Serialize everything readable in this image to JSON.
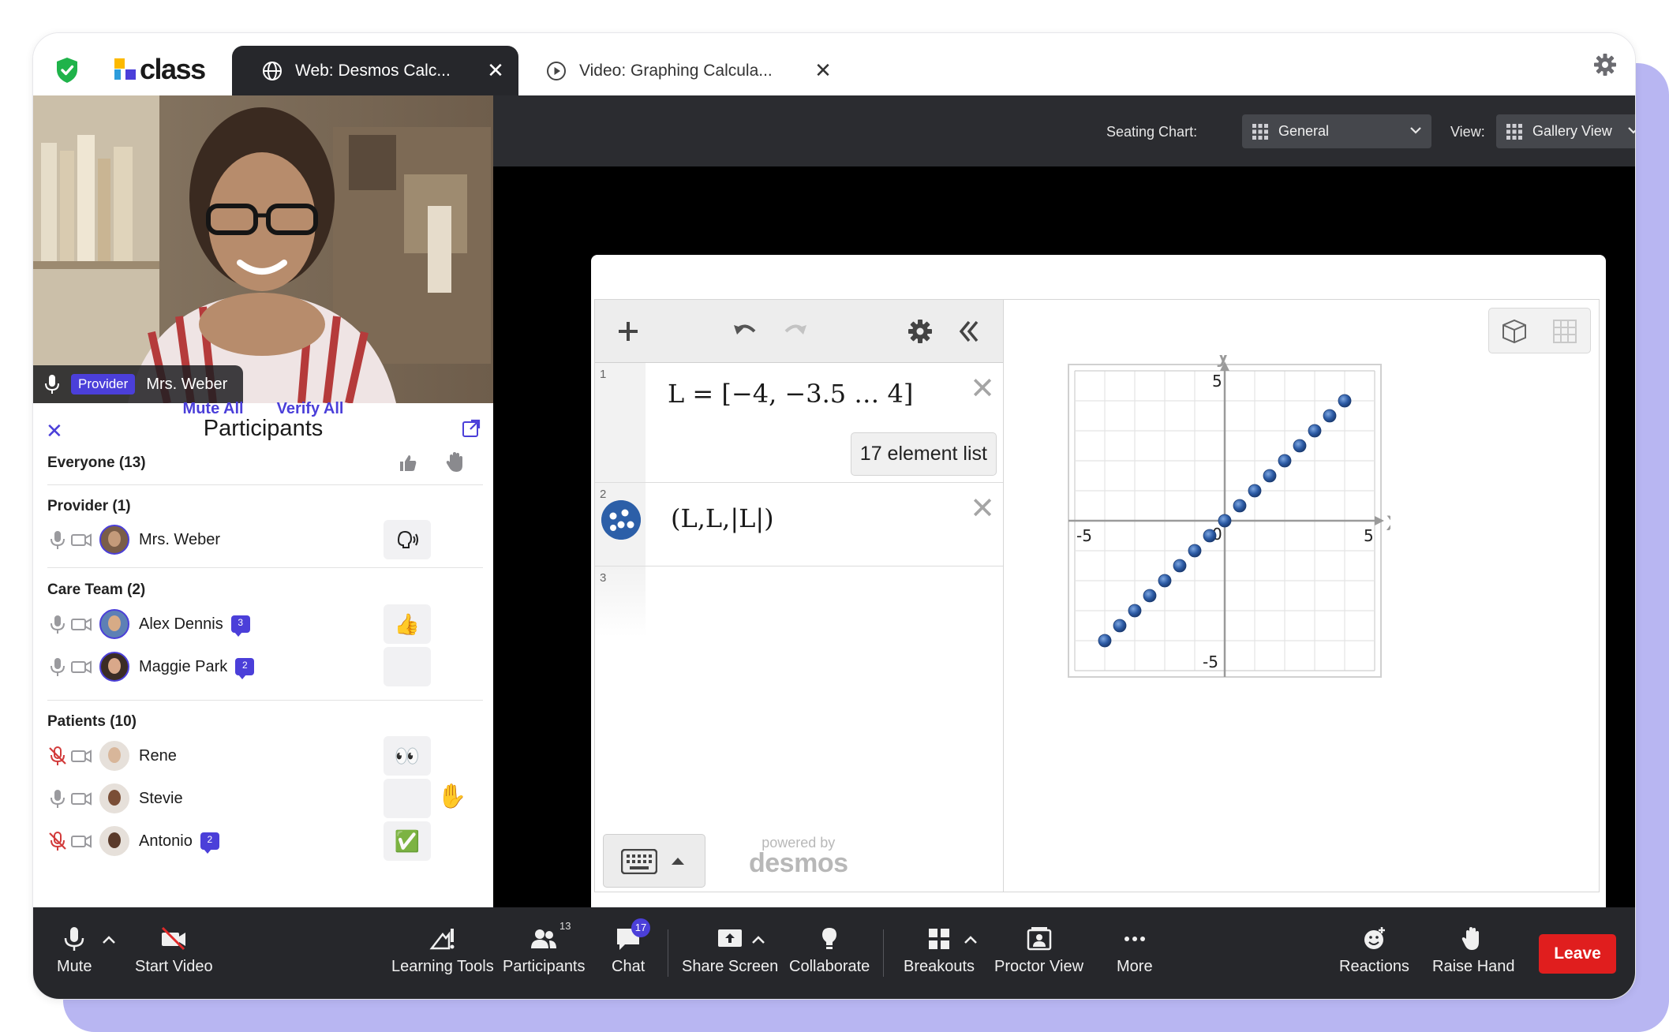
{
  "app": {
    "logo_text": "class",
    "tabs": [
      {
        "label": "Web: Desmos Calc...",
        "icon": "globe-icon",
        "active": true
      },
      {
        "label": "Video: Graphing Calcula...",
        "icon": "play-circle-icon",
        "active": false
      }
    ],
    "close_glyph": "✕"
  },
  "video": {
    "speaker_role": "Provider",
    "speaker_name": "Mrs. Weber"
  },
  "participants_panel": {
    "title": "Participants",
    "mute_all": "Mute All",
    "verify_all": "Verify All",
    "everyone": "Everyone (13)",
    "groups": {
      "provider": {
        "label": "Provider (1)",
        "members": [
          {
            "name": "Mrs. Weber",
            "reaction": "speaking-icon"
          }
        ]
      },
      "care_team": {
        "label": "Care Team (2)",
        "members": [
          {
            "name": "Alex Dennis",
            "messages": "3",
            "reaction": "👍"
          },
          {
            "name": "Maggie Park",
            "messages": "2",
            "reaction": ""
          }
        ]
      },
      "patients": {
        "label": "Patients (10)",
        "members": [
          {
            "name": "Rene",
            "muted": true,
            "reaction": "👀"
          },
          {
            "name": "Stevie",
            "muted": false,
            "reaction": "",
            "hand": "✋"
          },
          {
            "name": "Antonio",
            "muted": true,
            "messages": "2",
            "reaction": "✅"
          }
        ]
      }
    }
  },
  "main_toolbar": {
    "seating_label": "Seating Chart:",
    "seating_value": "General",
    "view_label": "View:",
    "view_value": "Gallery View"
  },
  "desmos": {
    "expressions": [
      {
        "num": "1",
        "latex_display": "L = [−4, −3.5 … 4]",
        "badge": "17 element list"
      },
      {
        "num": "2",
        "latex_display": "(L,L,|L|)"
      },
      {
        "num": "3",
        "latex_display": ""
      }
    ],
    "powered_by": "powered by",
    "brand": "desmos",
    "graph": {
      "x_label": "x",
      "y_label": "y",
      "tick_labels": {
        "x_min": "-5",
        "x_max": "5",
        "y_min": "-5",
        "y_max": "5",
        "origin": "0"
      }
    }
  },
  "chart_data": {
    "type": "scatter",
    "title": "",
    "xlabel": "x",
    "ylabel": "y",
    "xlim": [
      -5,
      5
    ],
    "ylim": [
      -5,
      5
    ],
    "grid": true,
    "series": [
      {
        "points": [
          [
            -4,
            -4
          ],
          [
            -3.5,
            -3.5
          ],
          [
            -3,
            -3
          ],
          [
            -2.5,
            -2.5
          ],
          [
            -2,
            -2
          ],
          [
            -1.5,
            -1.5
          ],
          [
            -1,
            -1
          ],
          [
            -0.5,
            -0.5
          ],
          [
            0,
            0
          ],
          [
            0.5,
            0.5
          ],
          [
            1,
            1
          ],
          [
            1.5,
            1.5
          ],
          [
            2,
            2
          ],
          [
            2.5,
            2.5
          ],
          [
            3,
            3
          ],
          [
            3.5,
            3.5
          ],
          [
            4,
            4
          ]
        ]
      }
    ],
    "point_color": "#2d5ca6"
  },
  "bottom_bar": {
    "mute": "Mute",
    "start_video": "Start Video",
    "learning_tools": "Learning Tools",
    "participants": "Participants",
    "participants_count": "13",
    "chat": "Chat",
    "chat_count": "17",
    "share_screen": "Share Screen",
    "collaborate": "Collaborate",
    "breakouts": "Breakouts",
    "proctor_view": "Proctor View",
    "more": "More",
    "reactions": "Reactions",
    "raise_hand": "Raise Hand",
    "leave": "Leave"
  },
  "colors": {
    "accent": "#4b3fd9",
    "leave": "#e01e1e",
    "dark_bar": "#26272b",
    "background_frame": "#b8b6f2"
  }
}
